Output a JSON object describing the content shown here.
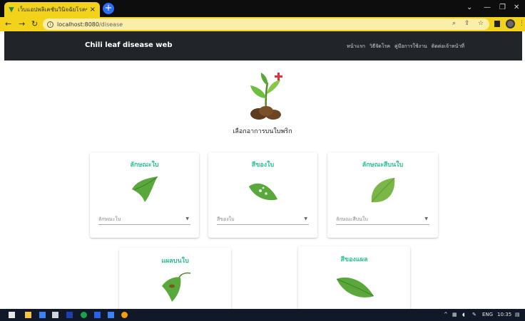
{
  "browser": {
    "tab_title": "เว็บแอปพลิเคชันวินิจฉัยโรคของใบพริก",
    "tab_close": "×",
    "new_tab": "+",
    "url_host": "localhost:8080",
    "url_path": "/disease",
    "win_min": "—",
    "win_max": "❐",
    "win_close": "✕"
  },
  "site": {
    "brand": "Chili leaf disease web",
    "menu": [
      "หน้าแรก",
      "วิธีจัดโรค",
      "คู่มือการใช้งาน",
      "ติดต่อเจ้าหน้าที่"
    ]
  },
  "hero": {
    "title": "เลือกอาการบนใบพริก"
  },
  "cards": [
    {
      "title": "ลักษณะใบ",
      "placeholder": "ลักษณะใบ"
    },
    {
      "title": "สีของใบ",
      "placeholder": "สีของใบ"
    },
    {
      "title": "ลักษณะสีบนใบ",
      "placeholder": "ลักษณะสีบนใบ"
    },
    {
      "title": "แผลบนใบ"
    },
    {
      "title": "สีของแผล"
    }
  ],
  "taskbar": {
    "tray_arrow": "^",
    "lang": "ENG",
    "time": "10:35"
  },
  "colors": {
    "accent": "#2fbf95",
    "browser_yellow": "#f3d21b",
    "navbar": "#212529",
    "leaf": "#5aa83c"
  }
}
